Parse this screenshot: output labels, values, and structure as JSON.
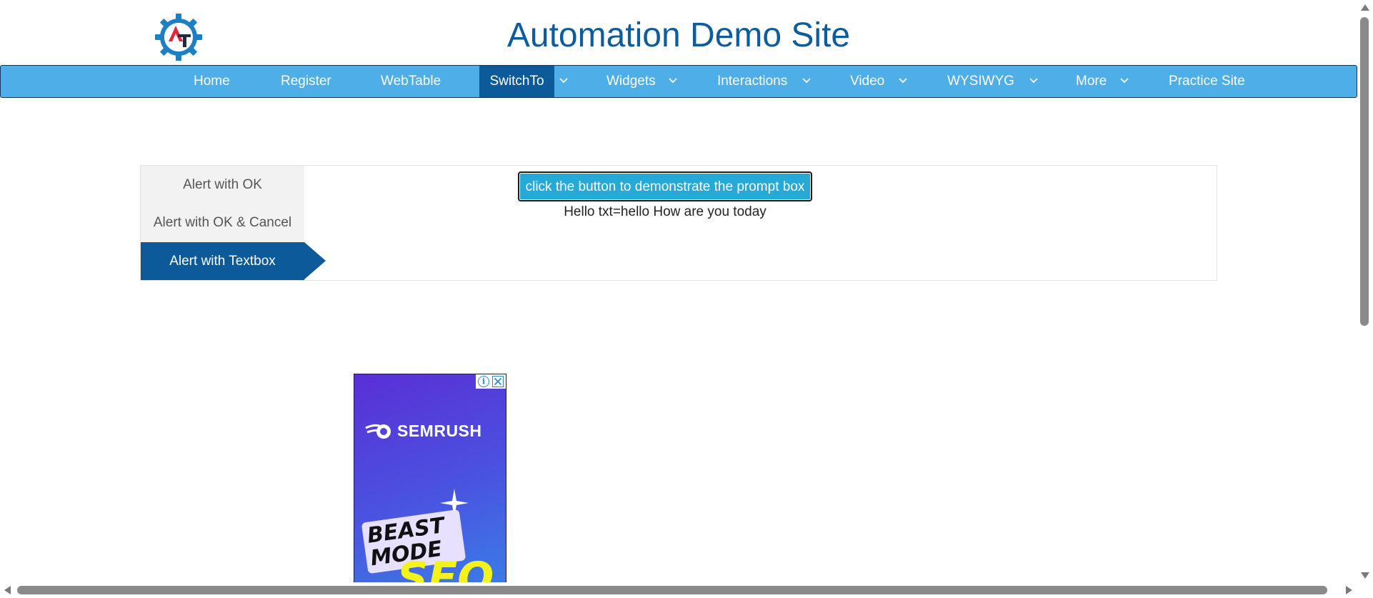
{
  "header": {
    "title": "Automation Demo Site",
    "logo_icon": "gear-logo-icon",
    "logo_colors": {
      "gear": "#1d7fc4",
      "mark": "#e0283c"
    }
  },
  "nav": {
    "items": [
      {
        "label": "Home",
        "has_dropdown": false
      },
      {
        "label": "Register",
        "has_dropdown": false
      },
      {
        "label": "WebTable",
        "has_dropdown": false
      },
      {
        "label": "SwitchTo",
        "has_dropdown": true,
        "active": true
      },
      {
        "label": "Widgets",
        "has_dropdown": true
      },
      {
        "label": "Interactions",
        "has_dropdown": true
      },
      {
        "label": "Video",
        "has_dropdown": true
      },
      {
        "label": "WYSIWYG",
        "has_dropdown": true
      },
      {
        "label": "More",
        "has_dropdown": true
      },
      {
        "label": "Practice Site",
        "has_dropdown": false
      }
    ],
    "background": "#4eaee8",
    "active_background": "#0c5a99"
  },
  "alerts": {
    "tabs": [
      {
        "label": "Alert with OK"
      },
      {
        "label": "Alert with OK & Cancel"
      },
      {
        "label": "Alert with Textbox",
        "active": true
      }
    ],
    "prompt_button_label": "click the button to demonstrate the prompt box",
    "result_text": "Hello txt=hello How are you today"
  },
  "ad": {
    "brand": "SEMRUSH",
    "beast_line1": "BEAST",
    "beast_line2": "MODE",
    "seo": "SEO",
    "info_glyph": "i",
    "info_icon": "info-icon",
    "close_icon": "close-icon"
  }
}
